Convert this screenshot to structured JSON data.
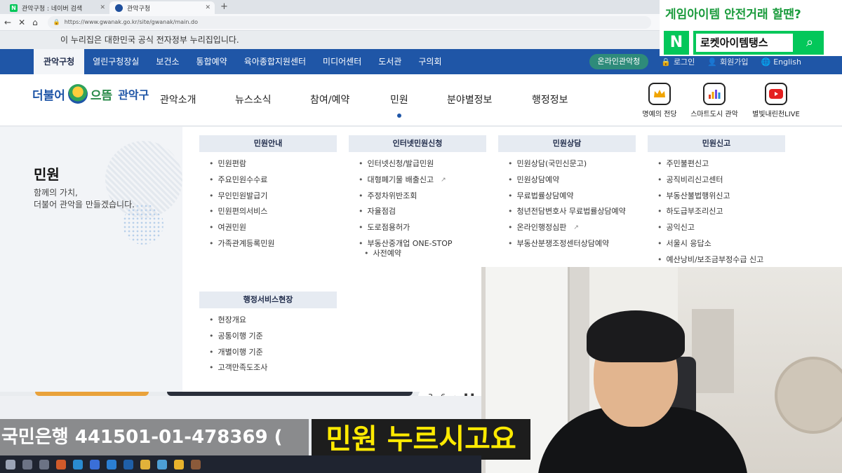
{
  "browser": {
    "tabs": [
      {
        "label": "관악구청 : 네이버 검색",
        "icon": "naver-favicon"
      },
      {
        "label": "관악구청",
        "icon": "gov-favicon"
      }
    ],
    "url": "https://www.gwanak.go.kr/site/gwanak/main.do"
  },
  "gov_notice": "이 누리집은 대한민국 공식 전자정부 누리집입니다.",
  "topnav": {
    "items": [
      "관악구청",
      "열린구청장실",
      "보건소",
      "통합예약",
      "육아종합지원센터",
      "미디어센터",
      "도서관",
      "구의회"
    ],
    "online": "온라인관악청",
    "login": "로그인",
    "signup": "회원가입",
    "english": "English"
  },
  "logo": {
    "t1": "더불어",
    "t2": "으뜸",
    "t3": "관악구"
  },
  "mainnav": [
    "관악소개",
    "뉴스소식",
    "참여/예약",
    "민원",
    "분야별정보",
    "행정정보"
  ],
  "quick": [
    {
      "label": "명예의 전당",
      "icon": "crown-icon",
      "color": "#f0a400"
    },
    {
      "label": "스마트도시 관악",
      "icon": "bar-chart-icon",
      "color": "#6c4ce0"
    },
    {
      "label": "별빛내린천LIVE",
      "icon": "youtube-icon",
      "color": "#e52020"
    }
  ],
  "mega": {
    "title": "민원",
    "desc": "함께의 가치,\n더불어 관악을 만들겠습니다.",
    "columns": [
      {
        "head": "민원안내",
        "items": [
          "민원편람",
          "주요민원수수료",
          "무인민원발급기",
          "민원편의서비스",
          "여권민원",
          "가족관계등록민원"
        ]
      },
      {
        "head": "인터넷민원신청",
        "items": [
          "인터넷신청/발급민원",
          "대형폐기물 배출신고",
          "주정차위반조회",
          "자율점검",
          "도로점용허가",
          "부동산중개업 ONE-STOP",
          "사전예약"
        ]
      },
      {
        "head": "민원상담",
        "items": [
          "민원상담(국민신문고)",
          "민원상담예약",
          "무료법률상담예약",
          "청년전담변호사 무료법률상담예약",
          "온라인행정심판",
          "부동산분쟁조정센터상담예약"
        ]
      },
      {
        "head": "민원신고",
        "items": [
          "주민불편신고",
          "공직비리신고센터",
          "부동산불법행위신고",
          "하도급부조리신고",
          "공익신고",
          "서울시 응답소",
          "예산낭비/보조금부정수급 신고"
        ]
      },
      {
        "head": "행정서비스현장",
        "items": [
          "현장개요",
          "공통이행 기준",
          "개별이행 기준",
          "고객만족도조사"
        ]
      }
    ]
  },
  "paging": "3 - 6",
  "promo": {
    "line1": "게임아이템 안전거래 할땐?",
    "n": "N",
    "search": "로켓아이템탱스",
    "brand_color": "#03c75a"
  },
  "bank_text": "국민은행 441501-01-478369 (",
  "caption": "민원 누르시고요"
}
